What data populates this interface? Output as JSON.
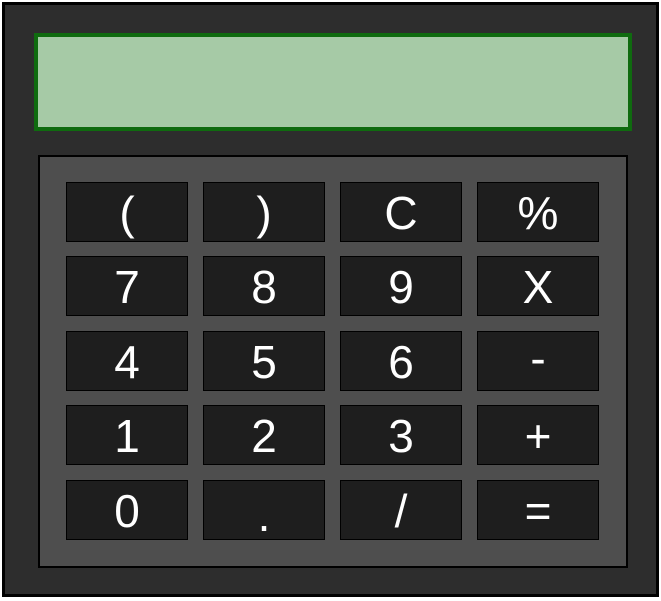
{
  "display": {
    "value": ""
  },
  "keys": {
    "open_paren": "(",
    "close_paren": ")",
    "clear": "C",
    "percent": "%",
    "seven": "7",
    "eight": "8",
    "nine": "9",
    "multiply": "X",
    "four": "4",
    "five": "5",
    "six": "6",
    "subtract": "-",
    "one": "1",
    "two": "2",
    "three": "3",
    "add": "+",
    "zero": "0",
    "decimal": ".",
    "divide": "/",
    "equals": "="
  },
  "colors": {
    "body": "#2d2d2d",
    "display_background": "#a6caa6",
    "display_border": "#0f6b0f",
    "keypad_background": "#4e4e4e",
    "key_background": "#1e1e1e",
    "key_text": "#ffffff"
  }
}
